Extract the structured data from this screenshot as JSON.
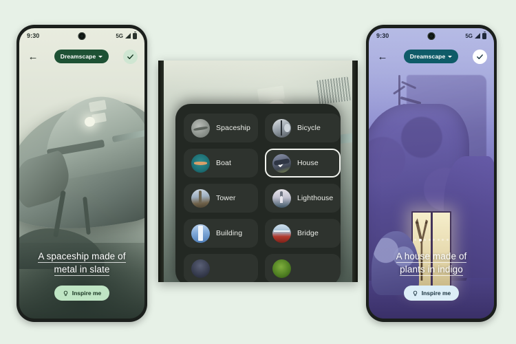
{
  "background_color": "#e7f1e7",
  "phones": {
    "left": {
      "status": {
        "time": "9:30",
        "network": "5G",
        "signal_icon": "signal-bars-icon",
        "battery_icon": "battery-icon"
      },
      "appbar": {
        "back_icon": "back-arrow-icon",
        "chip_label": "Dreamscape",
        "chip_caret_icon": "chevron-down-icon",
        "chip_color": "#1e5134",
        "confirm_icon": "check-icon",
        "confirm_bg": "#cfe6d2"
      },
      "caption_line1": "A spaceship made of",
      "caption_line2": "metal in slate",
      "inspire_label": "Inspire me",
      "inspire_icon": "lightbulb-icon",
      "inspire_bg": "#bfe5c4",
      "inspire_fg": "#16321f",
      "status_fg": "#2a332c",
      "artwork": "spaceship-misty-slate",
      "dots_total": 0,
      "dots_active": -1
    },
    "right": {
      "status": {
        "time": "9:30",
        "network": "5G",
        "signal_icon": "signal-bars-icon",
        "battery_icon": "battery-icon"
      },
      "appbar": {
        "back_icon": "back-arrow-icon",
        "chip_label": "Dreamscape",
        "chip_caret_icon": "chevron-down-icon",
        "chip_color": "#0f5b68",
        "confirm_icon": "check-icon",
        "confirm_bg": "#ffffff"
      },
      "caption_line1": "A house made of",
      "caption_line2": "plants in indigo",
      "inspire_label": "Inspire me",
      "inspire_icon": "lightbulb-icon",
      "inspire_bg": "#dceef7",
      "inspire_fg": "#17303c",
      "status_fg": "#20283a",
      "artwork": "house-plants-indigo",
      "dots_total": 8,
      "dots_active": 1
    }
  },
  "middle_panel": {
    "title": "subject-picker-sheet",
    "background_artwork": "spaceship-closeup",
    "sheet_bg": "#232823",
    "selected_option": "House",
    "options": [
      {
        "label": "Spaceship",
        "thumb": "tb-spaceship",
        "selected": false
      },
      {
        "label": "Bicycle",
        "thumb": "tb-bicycle",
        "selected": false
      },
      {
        "label": "Boat",
        "thumb": "tb-boat",
        "selected": false
      },
      {
        "label": "House",
        "thumb": "tb-house",
        "selected": true
      },
      {
        "label": "Tower",
        "thumb": "tb-tower",
        "selected": false
      },
      {
        "label": "Lighthouse",
        "thumb": "tb-lighthouse",
        "selected": false
      },
      {
        "label": "Building",
        "thumb": "tb-building",
        "selected": false
      },
      {
        "label": "Bridge",
        "thumb": "tb-bridge",
        "selected": false
      },
      {
        "label": "",
        "thumb": "tb-dark",
        "selected": false
      },
      {
        "label": "",
        "thumb": "tb-green",
        "selected": false
      }
    ]
  }
}
